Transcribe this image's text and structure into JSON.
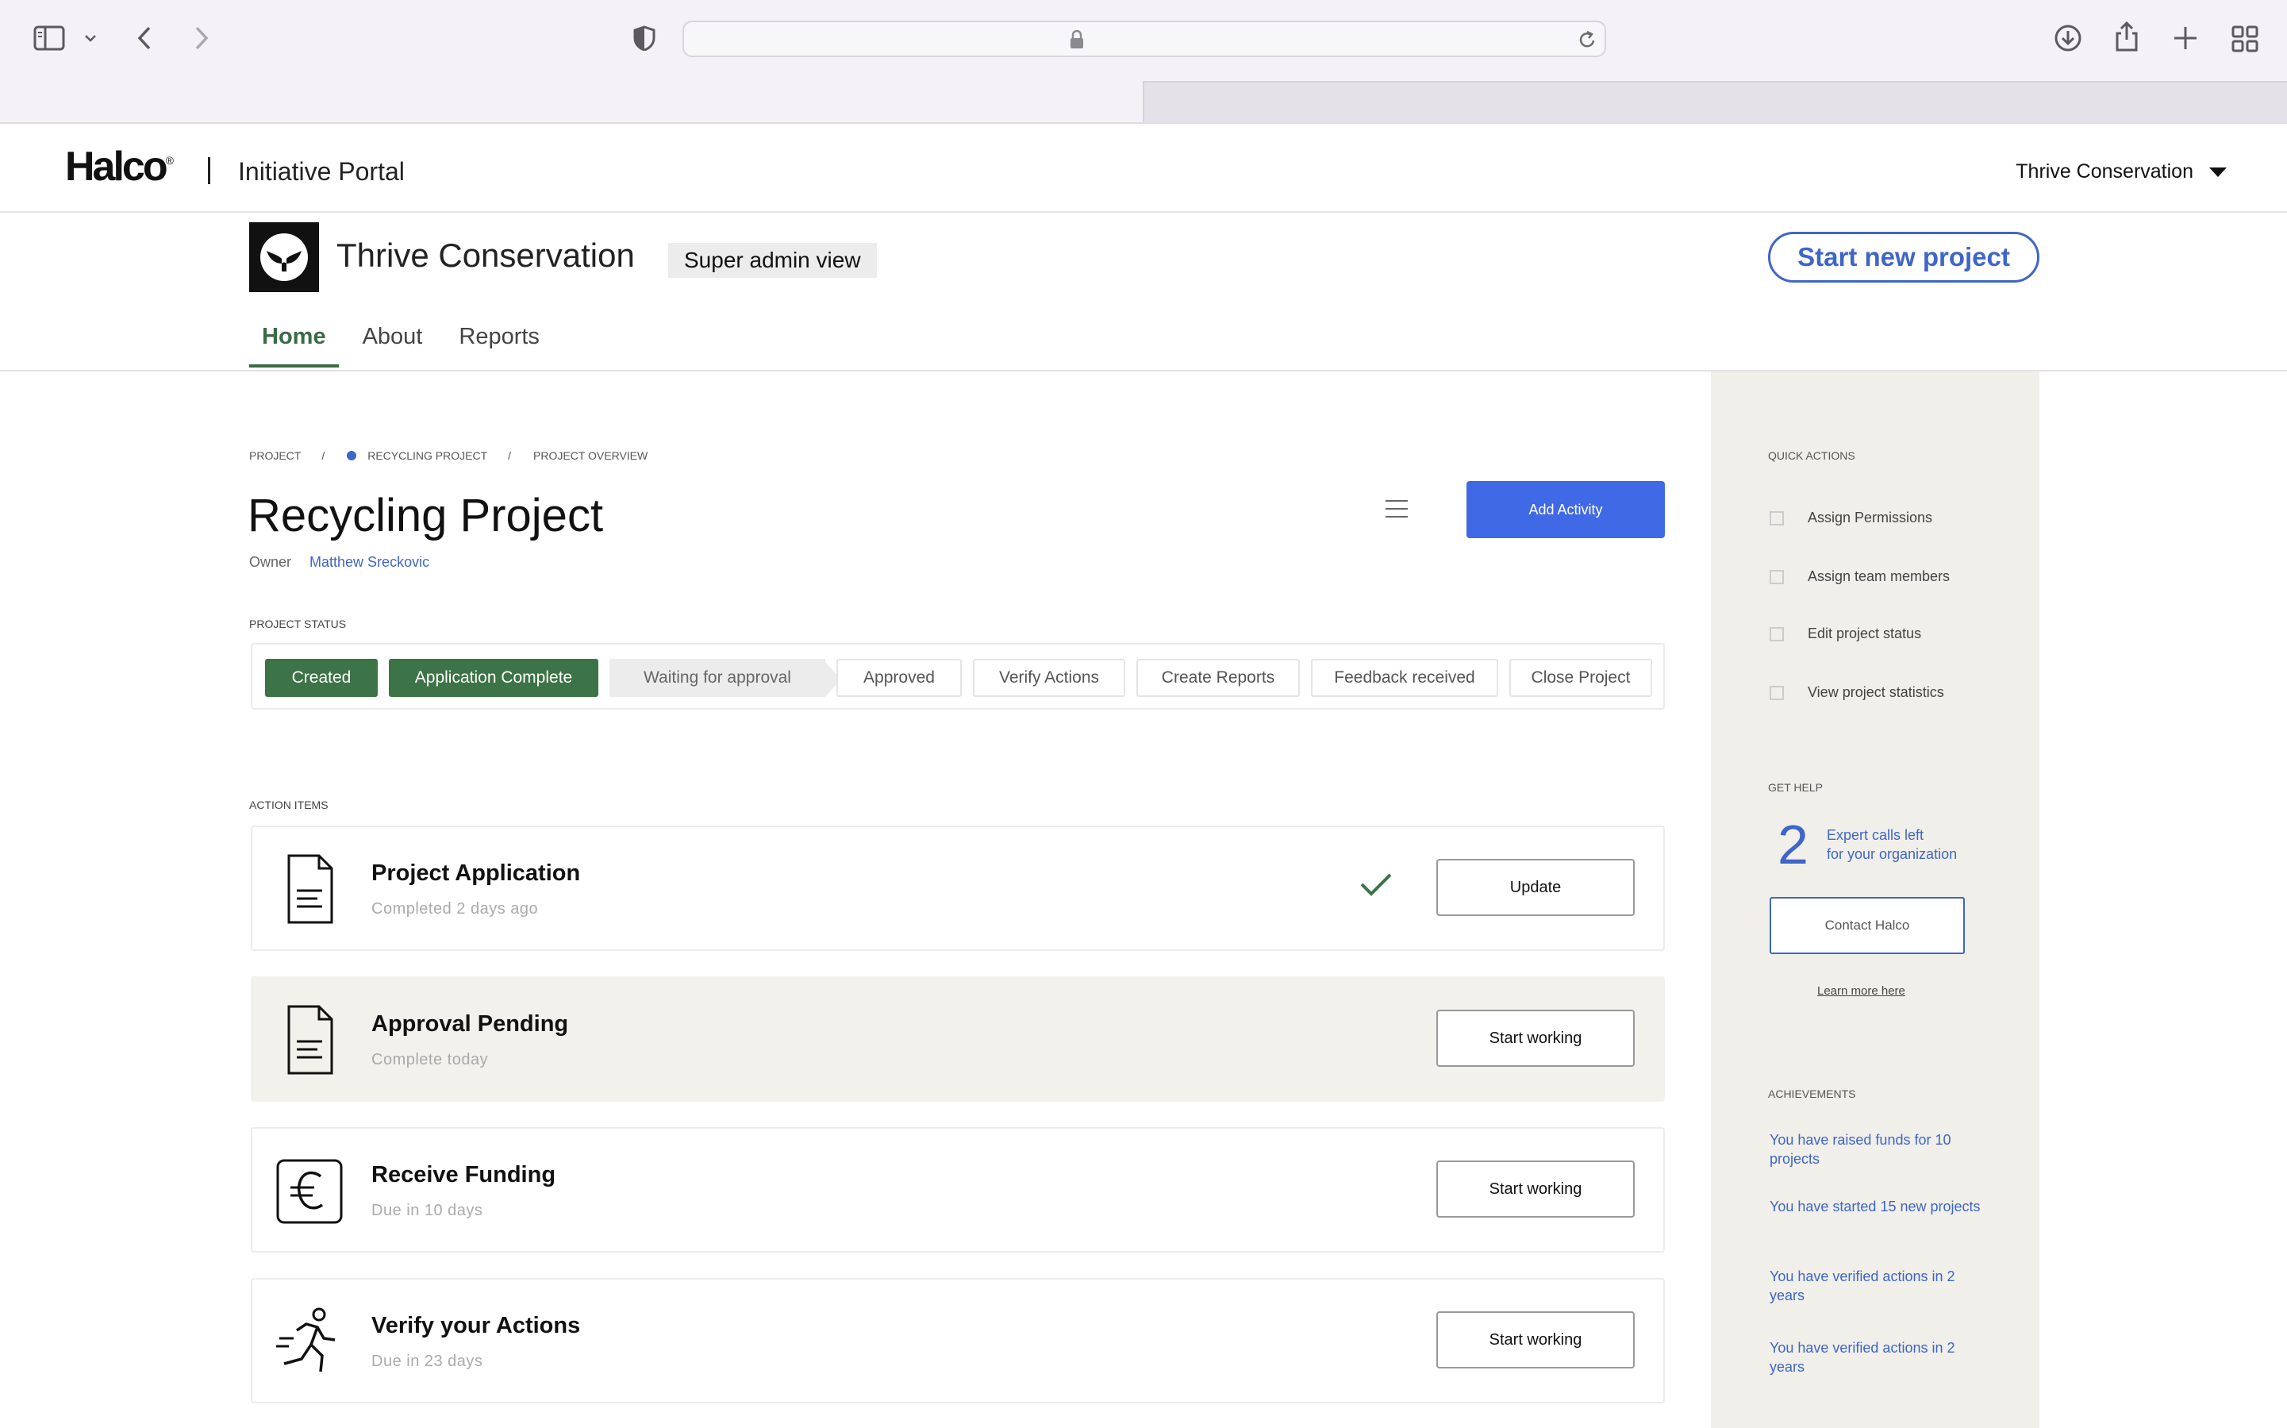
{
  "browser": {
    "icons": [
      "sidebar-icon",
      "chevron-down-icon",
      "back-icon",
      "forward-icon",
      "shield-icon",
      "lock-icon",
      "reload-icon",
      "download-icon",
      "share-icon",
      "new-tab-icon",
      "tab-overview-icon"
    ]
  },
  "header": {
    "logo": "Halco",
    "logo_mark": "®",
    "portal_title": "Initiative Portal",
    "org_selector": "Thrive Conservation"
  },
  "org": {
    "name": "Thrive Conservation",
    "badge": "Super admin view",
    "cta": "Start new project",
    "tabs": [
      {
        "label": "Home",
        "active": true
      },
      {
        "label": "About",
        "active": false
      },
      {
        "label": "Reports",
        "active": false
      }
    ]
  },
  "breadcrumb": {
    "items": [
      "Project",
      "Recycling Project",
      "Project Overview"
    ],
    "separator": "/"
  },
  "project": {
    "title": "Recycling Project",
    "owner_label": "Owner",
    "owner_name": "Matthew Sreckovic",
    "add_activity": "Add Activity"
  },
  "status": {
    "label": "Project Status",
    "steps": [
      {
        "label": "Created",
        "state": "done"
      },
      {
        "label": "Application Complete",
        "state": "done"
      },
      {
        "label": "Waiting for approval",
        "state": "current"
      },
      {
        "label": "Approved",
        "state": "pending"
      },
      {
        "label": "Verify Actions",
        "state": "pending"
      },
      {
        "label": "Create Reports",
        "state": "pending"
      },
      {
        "label": "Feedback received",
        "state": "pending"
      },
      {
        "label": "Close Project",
        "state": "pending"
      }
    ]
  },
  "actions": {
    "label": "Action Items",
    "items": [
      {
        "title": "Project Application",
        "subtitle": "Completed 2 days ago",
        "button": "Update",
        "icon": "document-icon",
        "completed": true
      },
      {
        "title": "Approval Pending",
        "subtitle": "Complete today",
        "button": "Start working",
        "icon": "document-icon",
        "completed": false
      },
      {
        "title": "Receive Funding",
        "subtitle": "Due in 10 days",
        "button": "Start working",
        "icon": "euro-icon",
        "completed": false
      },
      {
        "title": "Verify your Actions",
        "subtitle": "Due in 23 days",
        "button": "Start working",
        "icon": "running-person-icon",
        "completed": false
      }
    ]
  },
  "sidebar": {
    "quick_actions_label": "Quick Actions",
    "quick_actions": [
      "Assign Permissions",
      "Assign team members",
      "Edit project status",
      "View project statistics"
    ],
    "help_label": "Get Help",
    "expert_calls": "2",
    "expert_calls_line1": "Expert calls left",
    "expert_calls_line2": "for your organization",
    "contact": "Contact Halco",
    "learn_more": "Learn more here",
    "achievements_label": "Achievements",
    "achievements": [
      "You have raised funds for 10 projects",
      "You have started 15 new projects",
      "You have verified actions in 2 years",
      "You have verified actions in 2 years"
    ]
  },
  "colors": {
    "accent_blue": "#3f65c8",
    "button_blue": "#4069e6",
    "status_green": "#3c7347",
    "sidebar_bg": "#f0efea"
  }
}
